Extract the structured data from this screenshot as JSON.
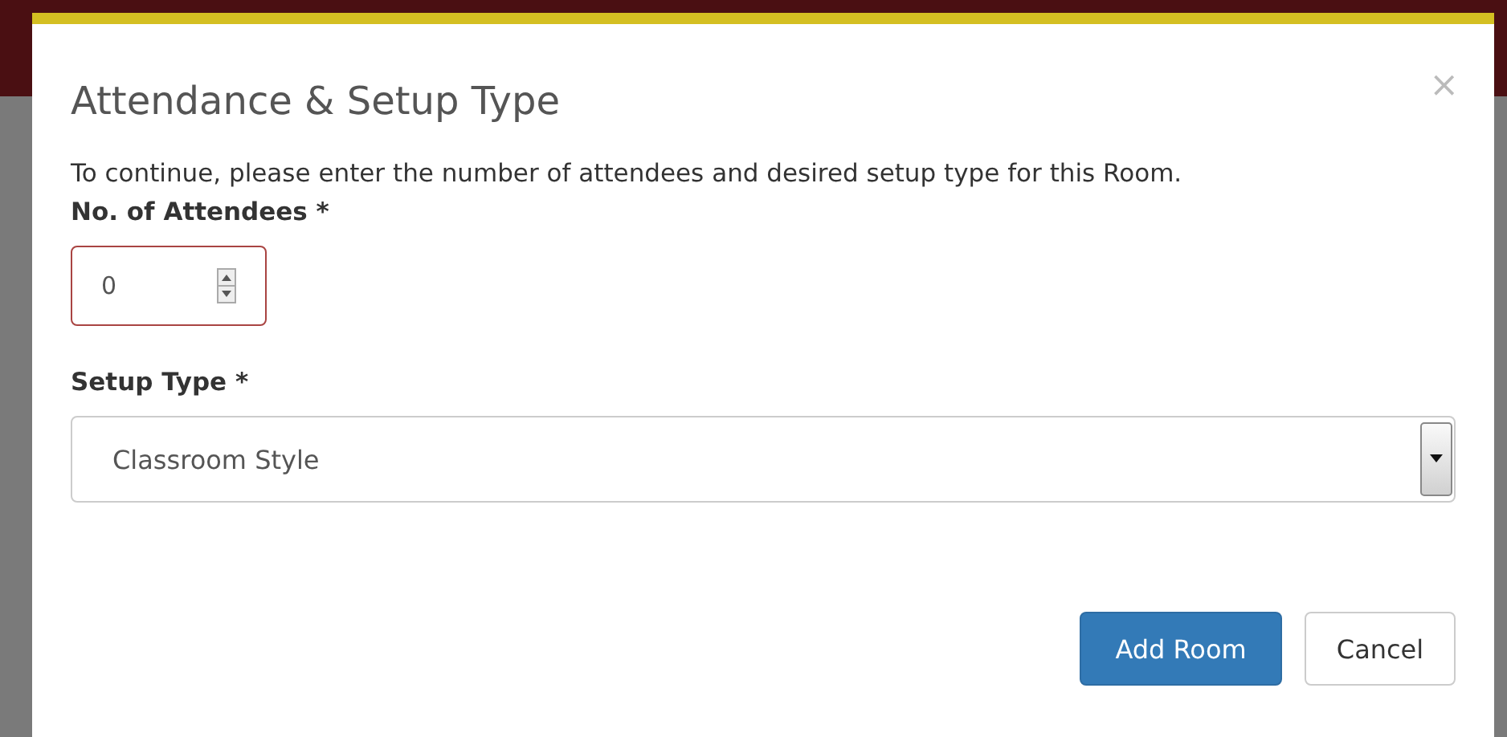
{
  "dialog": {
    "title": "Attendance & Setup Type",
    "close": "×",
    "description": "To continue, please enter the number of attendees and desired setup type for this Room."
  },
  "attendees": {
    "label": "No. of Attendees *",
    "value": "0",
    "invalid": true
  },
  "setup_type": {
    "label": "Setup Type *",
    "value": "Classroom Style"
  },
  "buttons": [
    {
      "label": "Add Room",
      "kind": "primary"
    },
    {
      "label": "Cancel",
      "kind": "default"
    }
  ]
}
